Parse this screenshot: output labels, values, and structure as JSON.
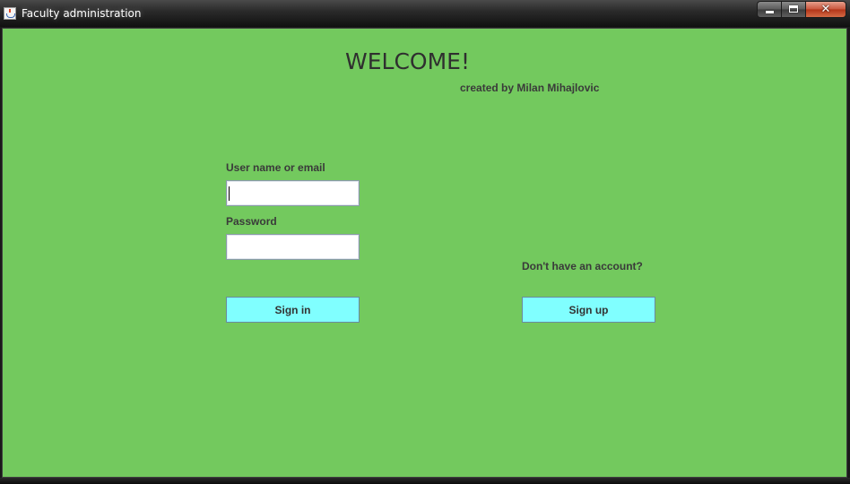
{
  "window": {
    "title": "Faculty administration",
    "icon": "java-cup-icon",
    "controls": {
      "minimize_icon": "minimize-icon",
      "maximize_icon": "maximize-icon",
      "close_icon": "close-icon",
      "close_glyph": "✕"
    }
  },
  "header": {
    "welcome": "WELCOME!",
    "credit": "created by Milan Mihajlovic"
  },
  "login": {
    "username_label": "User name or email",
    "username_value": "",
    "password_label": "Password",
    "password_value": "",
    "sign_in_label": "Sign in"
  },
  "signup": {
    "prompt": "Don't have an account?",
    "sign_up_label": "Sign up"
  },
  "colors": {
    "background": "#73c95e",
    "button": "#80ffff",
    "text": "#3a3a3a"
  }
}
